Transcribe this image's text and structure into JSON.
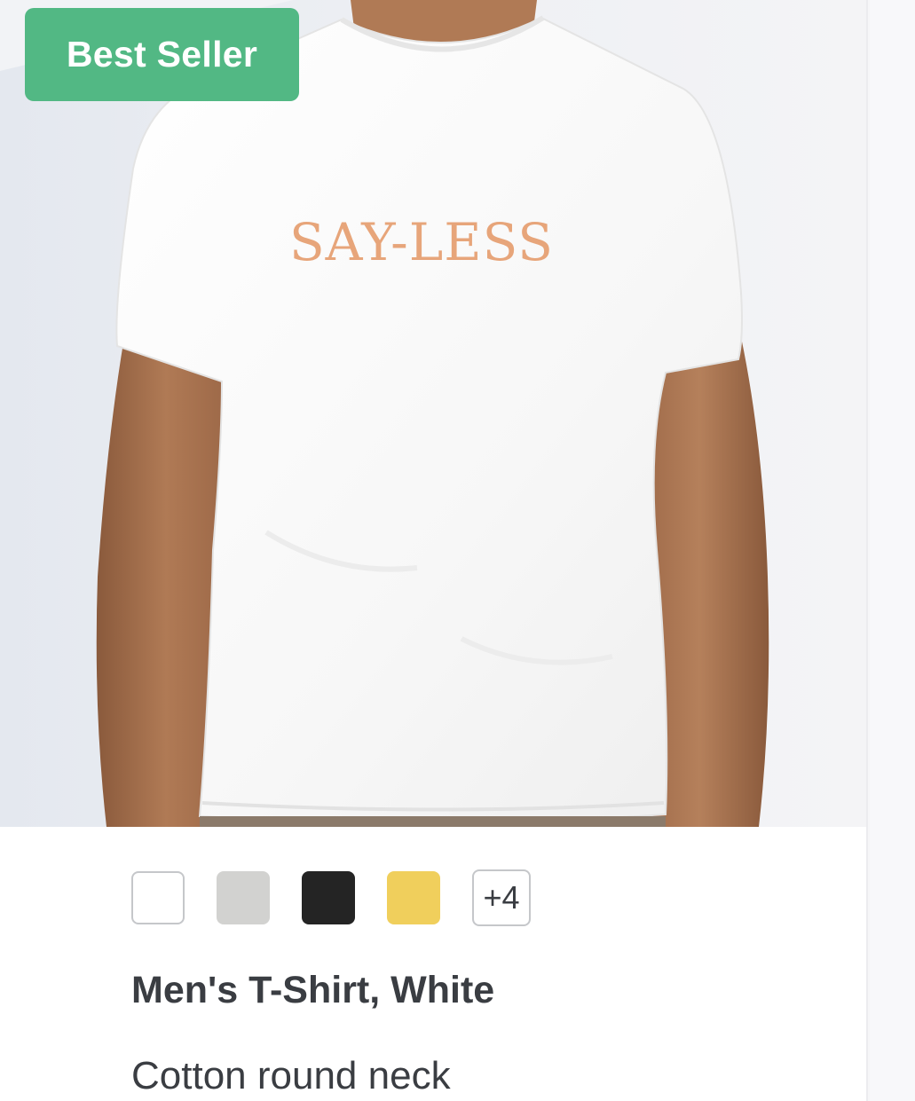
{
  "badge": {
    "label": "Best Seller",
    "color": "#52b884"
  },
  "product_image": {
    "icon": "tshirt-model-photo",
    "print_text": "SAY-LESS",
    "print_color": "#e7a57a"
  },
  "swatches": [
    {
      "name": "white",
      "color": "#ffffff"
    },
    {
      "name": "grey",
      "color": "#d2d2d0"
    },
    {
      "name": "black",
      "color": "#242424"
    },
    {
      "name": "yellow",
      "color": "#f0cf5c"
    }
  ],
  "more_colors": {
    "label": "+4"
  },
  "product": {
    "title": "Men's T-Shirt, White",
    "subtitle": "Cotton round neck"
  }
}
